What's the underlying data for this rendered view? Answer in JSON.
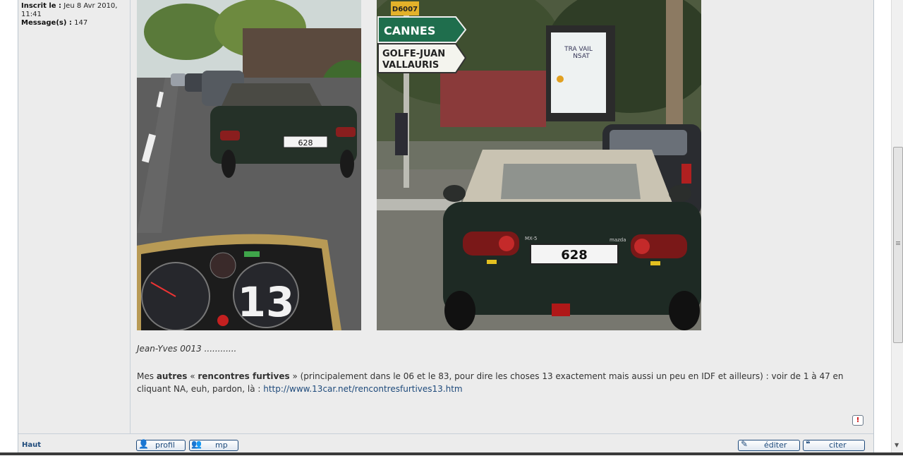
{
  "user": {
    "registered_label": "Inscrit le :",
    "registered_value": "Jeu 8 Avr 2010, 11:41",
    "messages_label": "Message(s) :",
    "messages_value": "147"
  },
  "photos": {
    "left": {
      "plate": "628",
      "sticker": "13"
    },
    "right": {
      "road_number": "D6007",
      "sign_top": "CANNES",
      "sign_bottom_line1": "GOLFE-JUAN",
      "sign_bottom_line2": "VALLAURIS",
      "plate": "628",
      "model": "MX-5",
      "brand": "mazda",
      "poster_line1": "TRA VAIL",
      "poster_line2": "NSAT"
    }
  },
  "signature": {
    "line1": "Jean-Yves 0013 ............",
    "para_start": "Mes ",
    "para_bold1": "autres",
    "para_mid": " « ",
    "para_bold2": "rencontres furtives",
    "para_rest": " » (principalement dans le 06 et le 83, pour dire les choses 13 exactement mais aussi un peu en IDF et ailleurs) : voir de 1 à 47 en cliquant NA, euh, pardon, là : ",
    "link": "http://www.13car.net/rencontresfurtives13.htm"
  },
  "report_icon": "!",
  "bottom": {
    "haut": "Haut",
    "profil": "profil",
    "mp": "mp",
    "editer": "éditer",
    "citer": "citer"
  },
  "icons": [
    "user-icon",
    "users-icon",
    "edit-icon",
    "quote-icon",
    "report-icon"
  ],
  "colors": {
    "link": "#1e4a7b",
    "panel": "#ececec",
    "border": "#bcc6cf"
  }
}
